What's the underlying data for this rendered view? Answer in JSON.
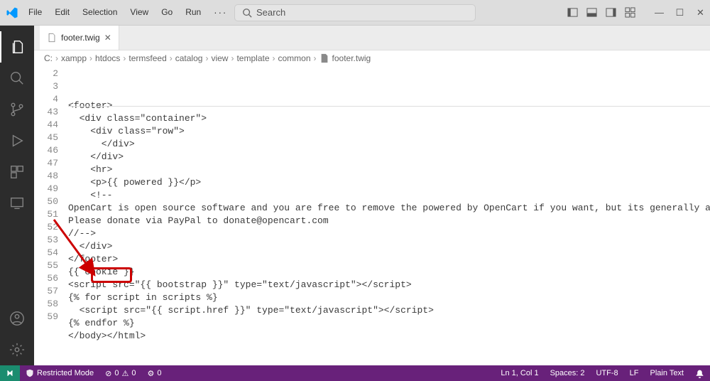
{
  "title": {
    "search_placeholder": "Search"
  },
  "menu": [
    "File",
    "Edit",
    "Selection",
    "View",
    "Go",
    "Run"
  ],
  "tab": {
    "name": "footer.twig"
  },
  "breadcrumbs": [
    "C:",
    "xampp",
    "htdocs",
    "termsfeed",
    "catalog",
    "view",
    "template",
    "common",
    "footer.twig"
  ],
  "code_lines": [
    {
      "n": 2,
      "t": "<footer>"
    },
    {
      "n": 3,
      "t": "  <div class=\"container\">"
    },
    {
      "n": 4,
      "t": "    <div class=\"row\">"
    },
    {
      "n": 43,
      "t": "      </div>"
    },
    {
      "n": 44,
      "t": "    </div>"
    },
    {
      "n": 45,
      "t": "    <hr>"
    },
    {
      "n": 46,
      "t": "    <p>{{ powered }}</p>"
    },
    {
      "n": 47,
      "t": "    <!--"
    },
    {
      "n": 48,
      "t": "OpenCart is open source software and you are free to remove the powered by OpenCart if you want, but its generally accepted practise to m"
    },
    {
      "n": 49,
      "t": "Please donate via PayPal to donate@opencart.com"
    },
    {
      "n": 50,
      "t": "//-->"
    },
    {
      "n": 51,
      "t": "  </div>"
    },
    {
      "n": 52,
      "t": "</footer>"
    },
    {
      "n": 53,
      "t": "{{ cookie }}"
    },
    {
      "n": 54,
      "t": "<script src=\"{{ bootstrap }}\" type=\"text/javascript\"></script>"
    },
    {
      "n": 55,
      "t": "{% for script in scripts %}"
    },
    {
      "n": 56,
      "t": "  <script src=\"{{ script.href }}\" type=\"text/javascript\"></script>"
    },
    {
      "n": 57,
      "t": "{% endfor %}"
    },
    {
      "n": 58,
      "t": "</body></html>"
    },
    {
      "n": 59,
      "t": ""
    }
  ],
  "status": {
    "restricted": "Restricted Mode",
    "problems": "0",
    "warnings": "0",
    "ports": "0",
    "cursor": "Ln 1, Col 1",
    "spaces": "Spaces: 2",
    "encoding": "UTF-8",
    "eol": "LF",
    "lang": "Plain Text"
  },
  "annotation": {
    "highlight": "</body>"
  }
}
